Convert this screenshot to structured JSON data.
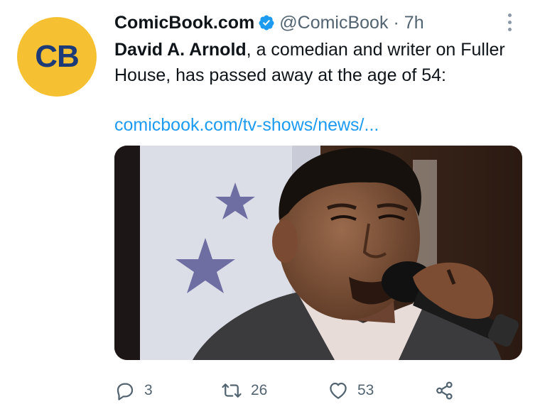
{
  "tweet": {
    "avatar_text": "CB",
    "display_name": "ComicBook.com",
    "handle": "@ComicBook",
    "separator": "·",
    "time": "7h",
    "text_bold": "David A. Arnold",
    "text_rest": ", a comedian and writer on Fuller House, has passed away at the age of 54:",
    "link": "comicbook.com/tv-shows/news/...",
    "media_icon": "photo-of-man-singing-into-microphone"
  },
  "actions": {
    "reply_count": "3",
    "retweet_count": "26",
    "like_count": "53"
  },
  "colors": {
    "avatar_bg": "#f5c133",
    "avatar_text": "#1d3a78",
    "verified": "#1d9bf0",
    "link": "#1d9bf0",
    "secondary": "#536471"
  }
}
